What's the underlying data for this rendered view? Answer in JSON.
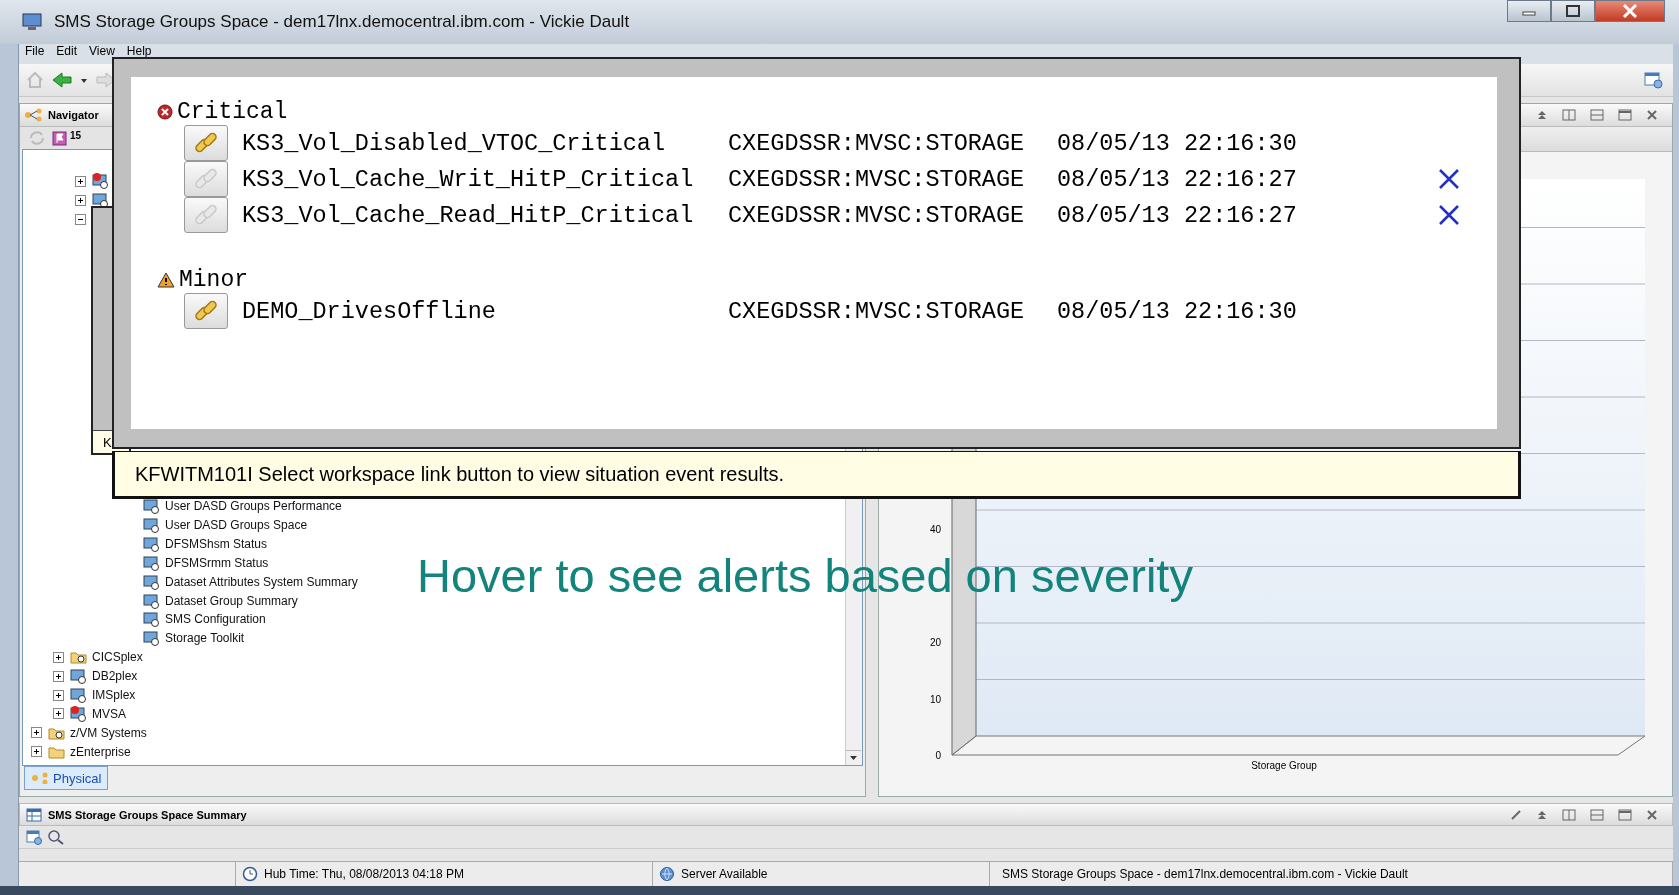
{
  "window": {
    "title": "SMS Storage Groups Space - dem17lnx.democentral.ibm.com - Vickie Dault"
  },
  "menu": [
    {
      "label": "File"
    },
    {
      "label": "Edit"
    },
    {
      "label": "View"
    },
    {
      "label": "Help"
    }
  ],
  "navigator": {
    "title": "Navigator",
    "event_count": "15",
    "tree": [
      {
        "children": [
          {
            "children": [
              {
                "kind": "monitor_alert",
                "expanded": false
              },
              {
                "kind": "monitor",
                "expanded": false
              },
              {
                "kind": "monitor",
                "expanded": true,
                "children": [
                  {
                    "kind": "monitor",
                    "label": "User DASD Groups Performance"
                  },
                  {
                    "kind": "monitor",
                    "label": "User DASD Groups Space"
                  },
                  {
                    "kind": "monitor",
                    "label": "DFSMShsm Status"
                  },
                  {
                    "kind": "monitor",
                    "label": "DFSMSrmm Status"
                  },
                  {
                    "kind": "monitor",
                    "label": "Dataset Attributes System Summary"
                  },
                  {
                    "kind": "monitor",
                    "label": "Dataset Group Summary"
                  },
                  {
                    "kind": "monitor",
                    "label": "SMS Configuration"
                  },
                  {
                    "kind": "monitor",
                    "label": "Storage Toolkit"
                  }
                ]
              }
            ]
          },
          {
            "kind": "folder_gear",
            "label": "CICSplex",
            "expanded": false
          },
          {
            "kind": "monitor",
            "label": "DB2plex",
            "expanded": false
          },
          {
            "kind": "monitor",
            "label": "IMSplex",
            "expanded": false
          },
          {
            "kind": "monitor_alert",
            "label": "MVSA",
            "expanded": false
          }
        ]
      },
      {
        "kind": "folder_gear",
        "label": "z/VM Systems",
        "expanded": false
      },
      {
        "kind": "folder",
        "label": "zEnterprise",
        "expanded": false
      }
    ],
    "tabs": [
      {
        "label": "Physical",
        "selected": true
      }
    ]
  },
  "chart": {
    "xlabel": "Storage Group",
    "yticks": [
      "40",
      "20",
      "10",
      "0"
    ]
  },
  "bottom_view": {
    "title": "SMS Storage Groups Space Summary"
  },
  "status_bar": {
    "hub_time": "Hub Time: Thu, 08/08/2013 04:18 PM",
    "server": "Server Available",
    "workspace": "SMS Storage Groups Space - dem17lnx.democentral.ibm.com - Vickie Dault"
  },
  "hidden_popup": {
    "message": "K"
  },
  "event_popup": {
    "groups": [
      {
        "kind": "critical",
        "label": "Critical",
        "events": [
          {
            "name": "KS3_Vol_Disabled_VTOC_Critical",
            "origin": "CXEGDSSR:MVSC:STORAGE",
            "timestamp": "08/05/13 22:16:30",
            "link_enabled": true,
            "closed": false
          },
          {
            "name": "KS3_Vol_Cache_Writ_HitP_Critical",
            "origin": "CXEGDSSR:MVSC:STORAGE",
            "timestamp": "08/05/13 22:16:27",
            "link_enabled": false,
            "closed": true
          },
          {
            "name": "KS3_Vol_Cache_Read_HitP_Critical",
            "origin": "CXEGDSSR:MVSC:STORAGE",
            "timestamp": "08/05/13 22:16:27",
            "link_enabled": false,
            "closed": true
          }
        ]
      },
      {
        "kind": "minor",
        "label": "Minor",
        "events": [
          {
            "name": "DEMO_DrivesOffline",
            "origin": "CXEGDSSR:MVSC:STORAGE",
            "timestamp": "08/05/13 22:16:30",
            "link_enabled": true,
            "closed": false
          }
        ]
      }
    ],
    "message": "KFWITM101I Select workspace link button to view situation event results."
  },
  "annotation": "Hover to see alerts based on severity"
}
